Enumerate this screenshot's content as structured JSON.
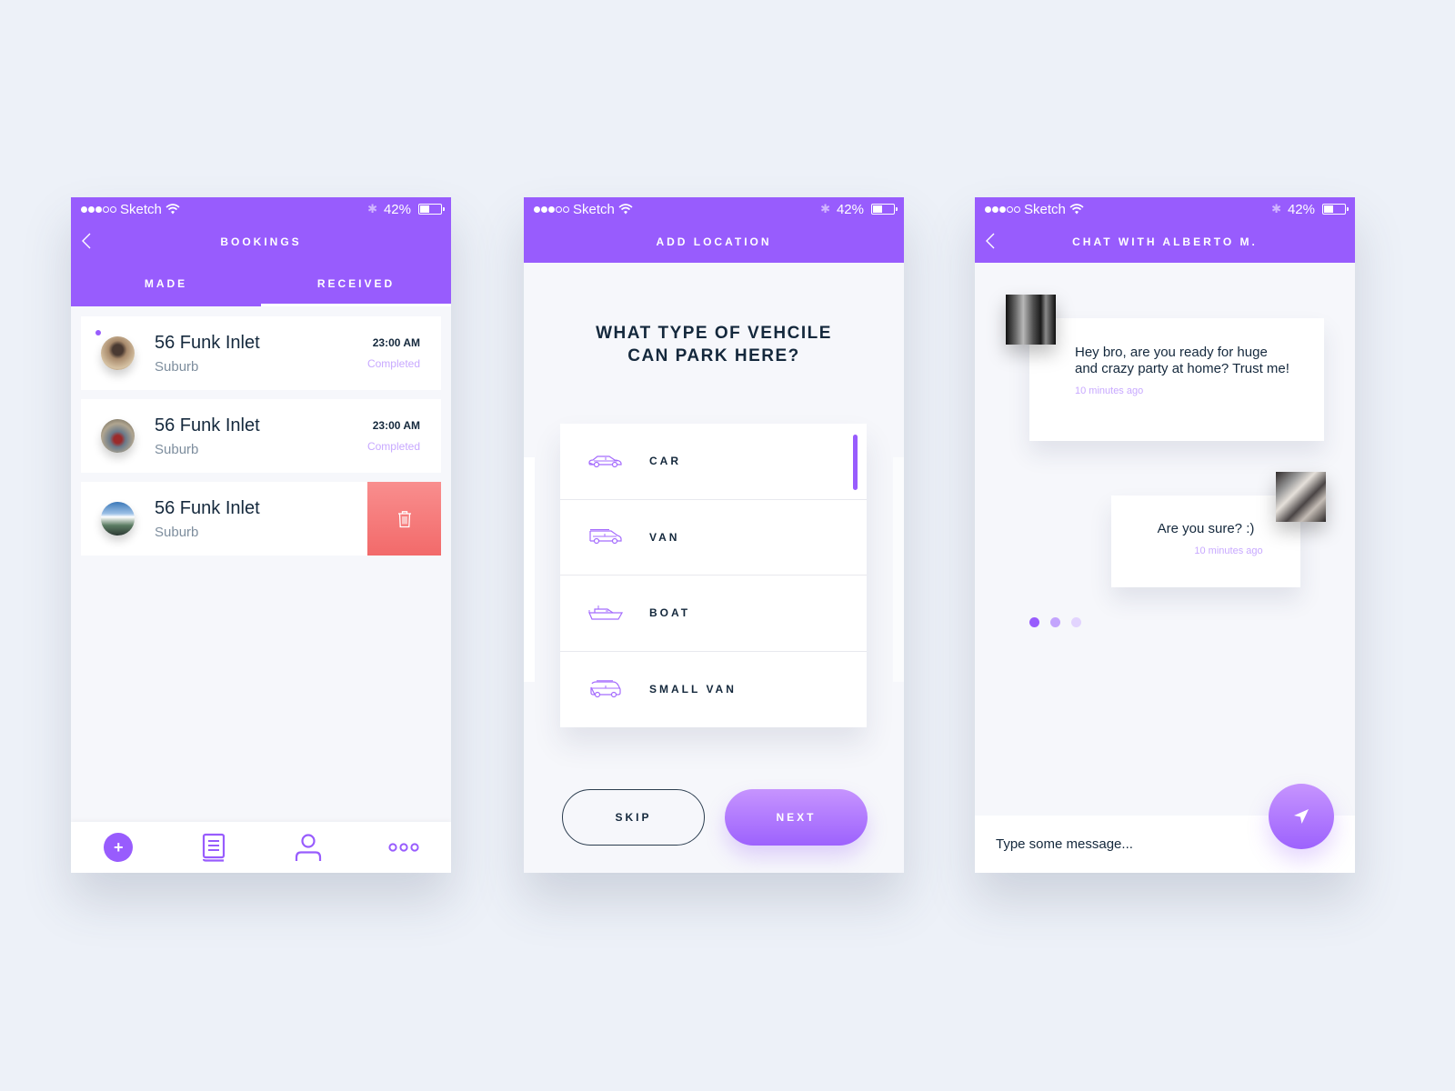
{
  "status_bar": {
    "carrier": "Sketch",
    "signal_bars_filled": 3,
    "signal_bars_total": 5,
    "battery_percent": "42%",
    "icons": [
      "wifi-icon",
      "bluetooth-icon",
      "battery-icon"
    ]
  },
  "colors": {
    "primary": "#985cfd",
    "danger": "#f26a6a",
    "text_dark": "#14283c",
    "muted": "#7e8e9e",
    "accent_light": "#c8a9ff",
    "background": "#edf1f8"
  },
  "bookings_screen": {
    "title": "BOOKINGS",
    "tabs": [
      {
        "label": "MADE",
        "active": false
      },
      {
        "label": "RECEIVED",
        "active": true
      }
    ],
    "items": [
      {
        "title": "56 Funk Inlet",
        "subtitle": "Suburb",
        "time": "23:00 AM",
        "status": "Completed",
        "unread": true
      },
      {
        "title": "56 Funk Inlet",
        "subtitle": "Suburb",
        "time": "23:00 AM",
        "status": "Completed",
        "unread": false
      },
      {
        "title": "56 Funk Inlet",
        "subtitle": "Suburb",
        "swiped": true,
        "action_icon": "trash-icon"
      }
    ],
    "tabbar": [
      {
        "name": "add",
        "icon": "plus-icon",
        "glyph": "+"
      },
      {
        "name": "bookings",
        "icon": "book-icon"
      },
      {
        "name": "profile",
        "icon": "user-icon"
      },
      {
        "name": "more",
        "icon": "more-icon"
      }
    ]
  },
  "add_location_screen": {
    "title": "ADD LOCATION",
    "question": "WHAT TYPE OF VEHCILE CAN PARK HERE?",
    "options": [
      {
        "label": "CAR",
        "icon": "car-icon",
        "selected": true
      },
      {
        "label": "VAN",
        "icon": "van-icon",
        "selected": false
      },
      {
        "label": "BOAT",
        "icon": "boat-icon",
        "selected": false
      },
      {
        "label": "SMALL VAN",
        "icon": "small-van-icon",
        "selected": false
      }
    ],
    "skip_label": "SKIP",
    "next_label": "NEXT"
  },
  "chat_screen": {
    "title": "CHAT WITH ALBERTO M.",
    "messages": [
      {
        "text": "Hey bro, are you ready for huge and crazy party at home? Trust me!",
        "time": "10 minutes ago",
        "side": "left"
      },
      {
        "text": "Are you sure? :)",
        "time": "10 minutes ago",
        "side": "right"
      }
    ],
    "typing_indicator_dots": 3,
    "composer_placeholder": "Type some message..."
  }
}
